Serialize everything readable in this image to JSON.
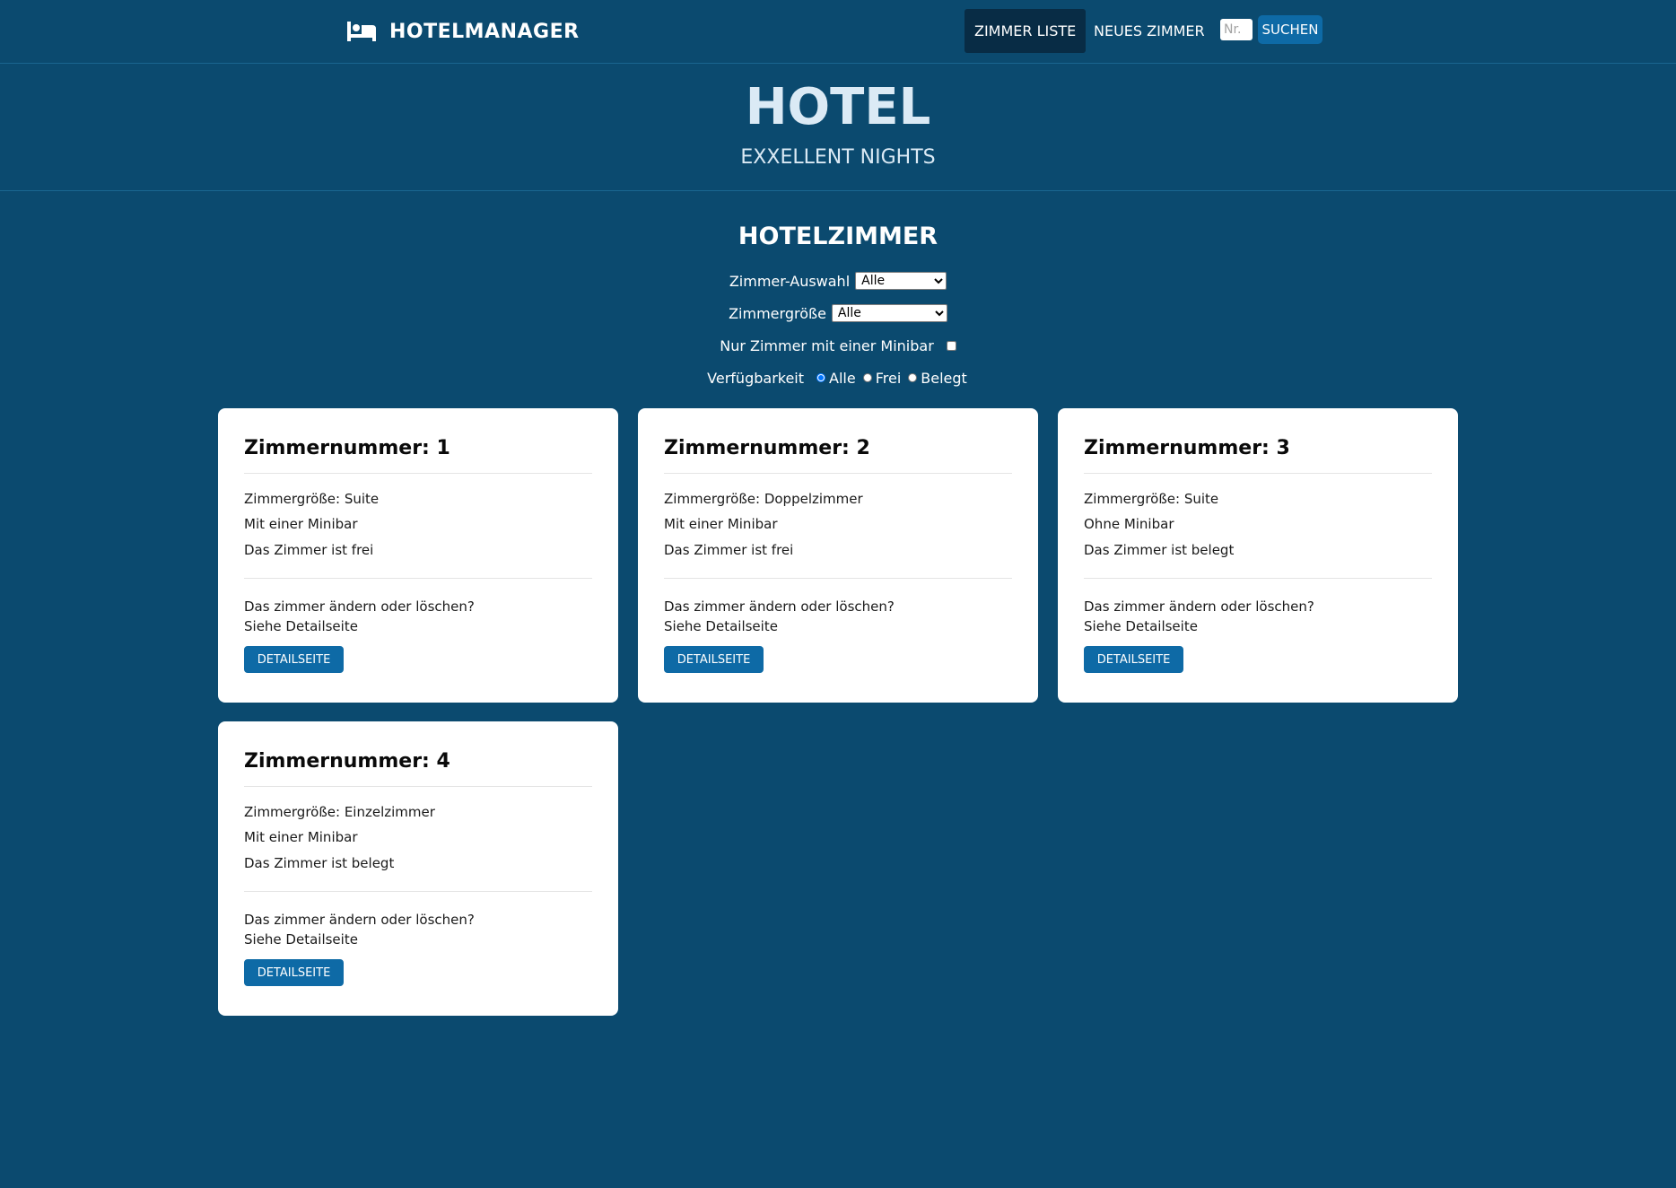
{
  "nav": {
    "brand": "HOTELMANAGER",
    "brand_icon": "bed-icon",
    "links": [
      "ZIMMER LISTE",
      "NEUES ZIMMER"
    ],
    "active_link": "ZIMMER LISTE",
    "search_placeholder": "Nr.",
    "search_button": "SUCHEN"
  },
  "hero": {
    "title": "HOTEL",
    "subtitle": "EXXELLENT NIGHTS"
  },
  "main": {
    "title": "HOTELZIMMER",
    "filters": {
      "room_selection_label": "Zimmer-Auswahl",
      "room_selection_value": "Alle",
      "room_size_label": "Zimmergröße",
      "room_size_value": "Alle",
      "minibar_label": "Nur Zimmer mit einer Minibar",
      "minibar_checked": false,
      "availability_label": "Verfügbarkeit",
      "availability_options": [
        "Alle",
        "Frei",
        "Belegt"
      ],
      "availability_selected": "Alle"
    },
    "rooms": [
      {
        "title": "Zimmernummer: 1",
        "size": "Zimmergröße: Suite",
        "minibar": "Mit einer Minibar",
        "status": "Das Zimmer ist frei",
        "prompt_line1": "Das zimmer ändern oder löschen?",
        "prompt_line2": "Siehe Detailseite",
        "button": "DETAILSEITE"
      },
      {
        "title": "Zimmernummer: 2",
        "size": "Zimmergröße: Doppelzimmer",
        "minibar": "Mit einer Minibar",
        "status": "Das Zimmer ist frei",
        "prompt_line1": "Das zimmer ändern oder löschen?",
        "prompt_line2": "Siehe Detailseite",
        "button": "DETAILSEITE"
      },
      {
        "title": "Zimmernummer: 3",
        "size": "Zimmergröße: Suite",
        "minibar": "Ohne Minibar",
        "status": "Das Zimmer ist belegt",
        "prompt_line1": "Das zimmer ändern oder löschen?",
        "prompt_line2": "Siehe Detailseite",
        "button": "DETAILSEITE"
      },
      {
        "title": "Zimmernummer: 4",
        "size": "Zimmergröße: Einzelzimmer",
        "minibar": "Mit einer Minibar",
        "status": "Das Zimmer ist belegt",
        "prompt_line1": "Das zimmer ändern oder löschen?",
        "prompt_line2": "Siehe Detailseite",
        "button": "DETAILSEITE"
      }
    ]
  },
  "colors": {
    "background": "#0b4a6f",
    "nav_active": "#082c45",
    "button": "#0e6aa6",
    "hero_text": "#dbeaf5",
    "card": "#ffffff"
  }
}
